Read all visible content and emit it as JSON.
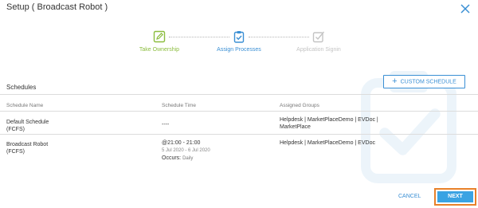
{
  "dialog": {
    "title": "Setup ( Broadcast Robot )"
  },
  "stepper": {
    "steps": [
      {
        "label": "Take Ownership",
        "state": "done",
        "color": "#8cbd3f"
      },
      {
        "label": "Assign Processes",
        "state": "active",
        "color": "#3a8fd4"
      },
      {
        "label": "Application Signin",
        "state": "pending",
        "color": "#bdbdbd"
      }
    ]
  },
  "schedules": {
    "title": "Schedules",
    "custom_button": "CUSTOM SCHEDULE",
    "columns": {
      "name": "Schedule Name",
      "time": "Schedule Time",
      "groups": "Assigned Groups"
    },
    "rows": [
      {
        "name_line1": "Default Schedule",
        "name_line2": "(FCFS)",
        "time": "----",
        "groups_line1": "Helpdesk | MarketPlaceDemo | EVDoc |",
        "groups_line2": "MarketPlace"
      },
      {
        "name_line1": "Broadcast Robot",
        "name_line2": "(FCFS)",
        "time": "@21:00 - 21:00",
        "date_range": "5 Jul 2020 - 6 Jul 2020",
        "occurs_label": "Occurs:",
        "occurs_value": "Daily",
        "groups_line1": "Helpdesk | MarketPlaceDemo | EVDoc"
      }
    ]
  },
  "footer": {
    "cancel": "CANCEL",
    "next": "NEXT"
  },
  "icons": {
    "close": "close-icon",
    "watermark": "clipboard-check-icon",
    "plus": "plus-icon"
  }
}
